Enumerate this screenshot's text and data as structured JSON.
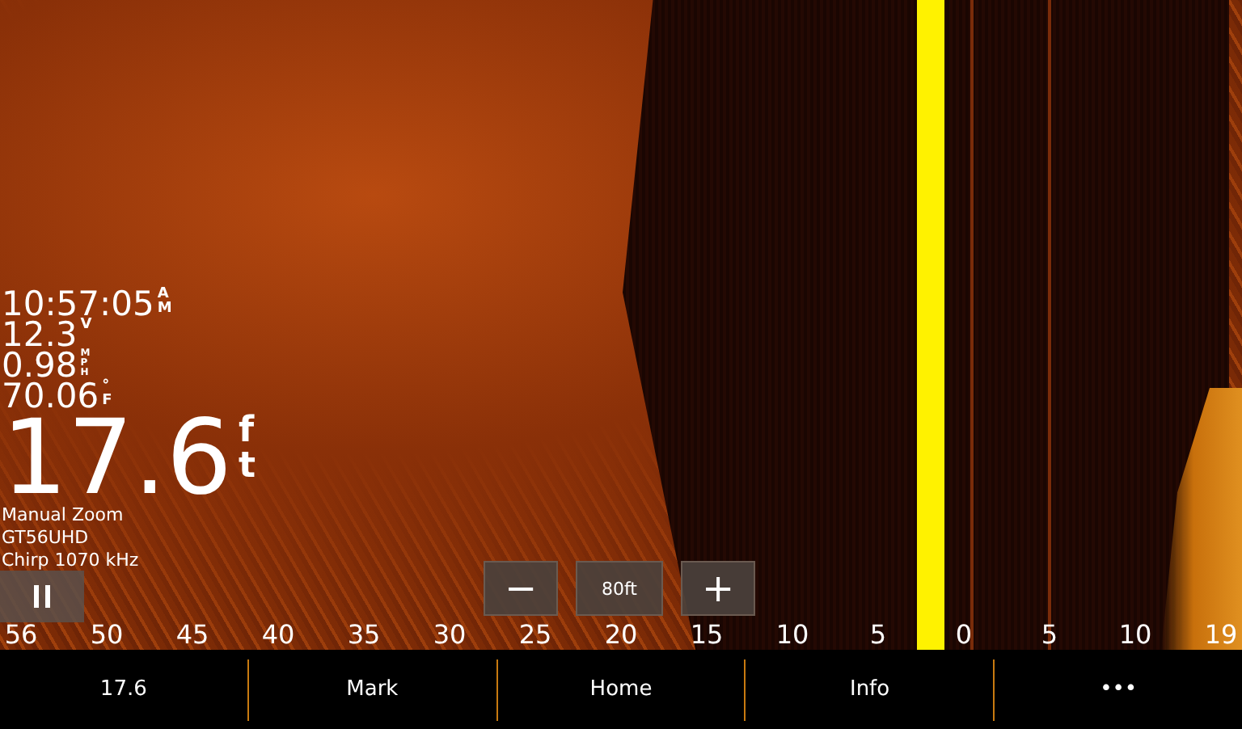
{
  "readouts": [
    {
      "value": "10:57:05",
      "unit": "AM"
    },
    {
      "value": "12.3",
      "unit": "V"
    },
    {
      "value": "0.98",
      "unit": "MPH"
    },
    {
      "value": "70.06",
      "unit": "°F"
    }
  ],
  "depth": {
    "value": "17.6",
    "unit": "ft"
  },
  "info_lines": [
    "Manual Zoom",
    "GT56UHD",
    "Chirp 1070 kHz"
  ],
  "zoom_controls": {
    "minus": "−",
    "range": "80ft",
    "plus": "+"
  },
  "scale": [
    "56",
    "50",
    "45",
    "40",
    "35",
    "30",
    "25",
    "20",
    "15",
    "10",
    "5",
    "0",
    "5",
    "10",
    "19"
  ],
  "bottom_bar": [
    "17.6",
    "Mark",
    "Home",
    "Info",
    "•••"
  ]
}
